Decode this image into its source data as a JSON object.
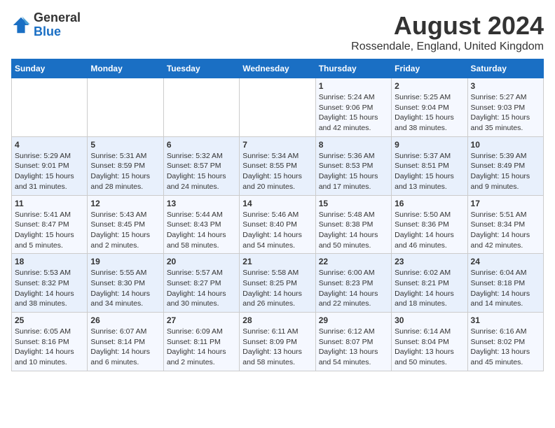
{
  "header": {
    "logo_line1": "General",
    "logo_line2": "Blue",
    "month_title": "August 2024",
    "subtitle": "Rossendale, England, United Kingdom"
  },
  "days_of_week": [
    "Sunday",
    "Monday",
    "Tuesday",
    "Wednesday",
    "Thursday",
    "Friday",
    "Saturday"
  ],
  "weeks": [
    [
      {
        "day": "",
        "info": ""
      },
      {
        "day": "",
        "info": ""
      },
      {
        "day": "",
        "info": ""
      },
      {
        "day": "",
        "info": ""
      },
      {
        "day": "1",
        "info": "Sunrise: 5:24 AM\nSunset: 9:06 PM\nDaylight: 15 hours\nand 42 minutes."
      },
      {
        "day": "2",
        "info": "Sunrise: 5:25 AM\nSunset: 9:04 PM\nDaylight: 15 hours\nand 38 minutes."
      },
      {
        "day": "3",
        "info": "Sunrise: 5:27 AM\nSunset: 9:03 PM\nDaylight: 15 hours\nand 35 minutes."
      }
    ],
    [
      {
        "day": "4",
        "info": "Sunrise: 5:29 AM\nSunset: 9:01 PM\nDaylight: 15 hours\nand 31 minutes."
      },
      {
        "day": "5",
        "info": "Sunrise: 5:31 AM\nSunset: 8:59 PM\nDaylight: 15 hours\nand 28 minutes."
      },
      {
        "day": "6",
        "info": "Sunrise: 5:32 AM\nSunset: 8:57 PM\nDaylight: 15 hours\nand 24 minutes."
      },
      {
        "day": "7",
        "info": "Sunrise: 5:34 AM\nSunset: 8:55 PM\nDaylight: 15 hours\nand 20 minutes."
      },
      {
        "day": "8",
        "info": "Sunrise: 5:36 AM\nSunset: 8:53 PM\nDaylight: 15 hours\nand 17 minutes."
      },
      {
        "day": "9",
        "info": "Sunrise: 5:37 AM\nSunset: 8:51 PM\nDaylight: 15 hours\nand 13 minutes."
      },
      {
        "day": "10",
        "info": "Sunrise: 5:39 AM\nSunset: 8:49 PM\nDaylight: 15 hours\nand 9 minutes."
      }
    ],
    [
      {
        "day": "11",
        "info": "Sunrise: 5:41 AM\nSunset: 8:47 PM\nDaylight: 15 hours\nand 5 minutes."
      },
      {
        "day": "12",
        "info": "Sunrise: 5:43 AM\nSunset: 8:45 PM\nDaylight: 15 hours\nand 2 minutes."
      },
      {
        "day": "13",
        "info": "Sunrise: 5:44 AM\nSunset: 8:43 PM\nDaylight: 14 hours\nand 58 minutes."
      },
      {
        "day": "14",
        "info": "Sunrise: 5:46 AM\nSunset: 8:40 PM\nDaylight: 14 hours\nand 54 minutes."
      },
      {
        "day": "15",
        "info": "Sunrise: 5:48 AM\nSunset: 8:38 PM\nDaylight: 14 hours\nand 50 minutes."
      },
      {
        "day": "16",
        "info": "Sunrise: 5:50 AM\nSunset: 8:36 PM\nDaylight: 14 hours\nand 46 minutes."
      },
      {
        "day": "17",
        "info": "Sunrise: 5:51 AM\nSunset: 8:34 PM\nDaylight: 14 hours\nand 42 minutes."
      }
    ],
    [
      {
        "day": "18",
        "info": "Sunrise: 5:53 AM\nSunset: 8:32 PM\nDaylight: 14 hours\nand 38 minutes."
      },
      {
        "day": "19",
        "info": "Sunrise: 5:55 AM\nSunset: 8:30 PM\nDaylight: 14 hours\nand 34 minutes."
      },
      {
        "day": "20",
        "info": "Sunrise: 5:57 AM\nSunset: 8:27 PM\nDaylight: 14 hours\nand 30 minutes."
      },
      {
        "day": "21",
        "info": "Sunrise: 5:58 AM\nSunset: 8:25 PM\nDaylight: 14 hours\nand 26 minutes."
      },
      {
        "day": "22",
        "info": "Sunrise: 6:00 AM\nSunset: 8:23 PM\nDaylight: 14 hours\nand 22 minutes."
      },
      {
        "day": "23",
        "info": "Sunrise: 6:02 AM\nSunset: 8:21 PM\nDaylight: 14 hours\nand 18 minutes."
      },
      {
        "day": "24",
        "info": "Sunrise: 6:04 AM\nSunset: 8:18 PM\nDaylight: 14 hours\nand 14 minutes."
      }
    ],
    [
      {
        "day": "25",
        "info": "Sunrise: 6:05 AM\nSunset: 8:16 PM\nDaylight: 14 hours\nand 10 minutes."
      },
      {
        "day": "26",
        "info": "Sunrise: 6:07 AM\nSunset: 8:14 PM\nDaylight: 14 hours\nand 6 minutes."
      },
      {
        "day": "27",
        "info": "Sunrise: 6:09 AM\nSunset: 8:11 PM\nDaylight: 14 hours\nand 2 minutes."
      },
      {
        "day": "28",
        "info": "Sunrise: 6:11 AM\nSunset: 8:09 PM\nDaylight: 13 hours\nand 58 minutes."
      },
      {
        "day": "29",
        "info": "Sunrise: 6:12 AM\nSunset: 8:07 PM\nDaylight: 13 hours\nand 54 minutes."
      },
      {
        "day": "30",
        "info": "Sunrise: 6:14 AM\nSunset: 8:04 PM\nDaylight: 13 hours\nand 50 minutes."
      },
      {
        "day": "31",
        "info": "Sunrise: 6:16 AM\nSunset: 8:02 PM\nDaylight: 13 hours\nand 45 minutes."
      }
    ]
  ]
}
